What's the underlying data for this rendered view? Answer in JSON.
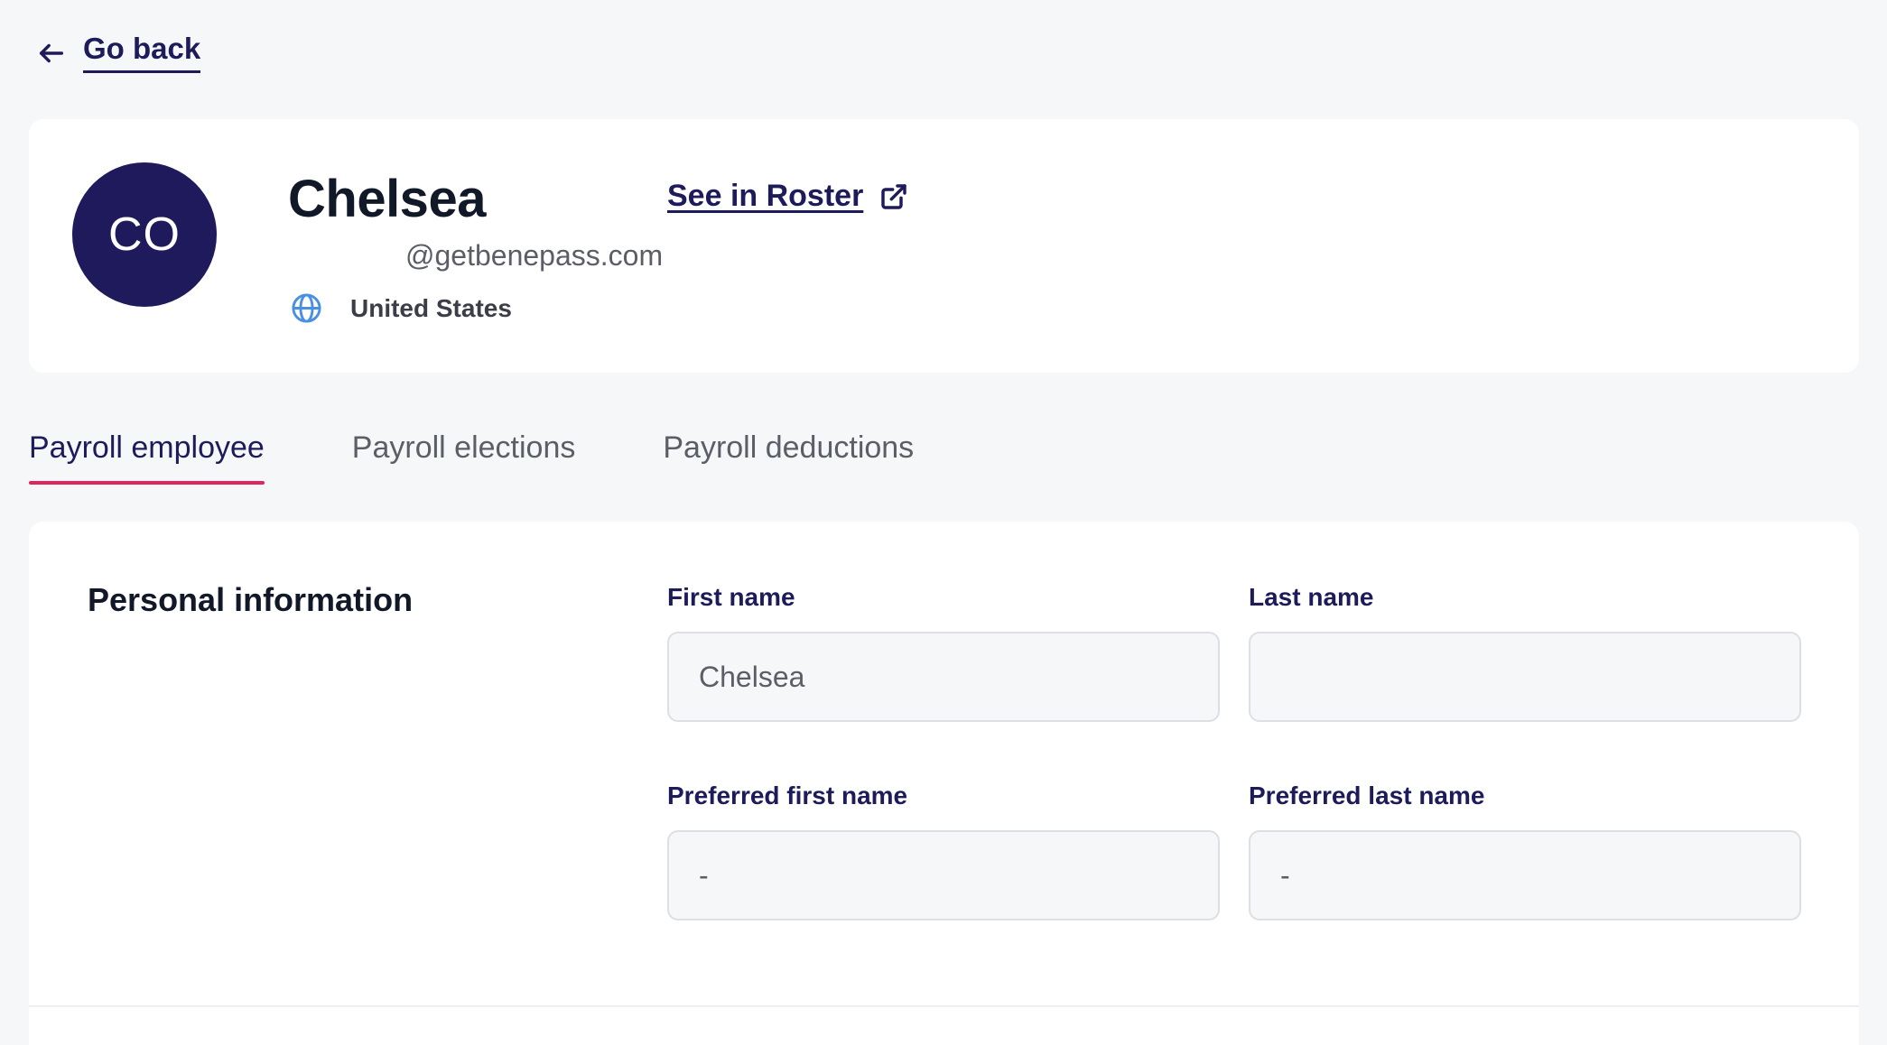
{
  "go_back": {
    "label": "Go back",
    "icon": "arrow-left-icon"
  },
  "profile": {
    "initials": "CO",
    "name": "Chelsea",
    "email": "@getbenepass.com",
    "country": "United States",
    "country_icon": "globe-icon",
    "roster_link": {
      "label": "See in Roster",
      "icon": "external-link-icon"
    }
  },
  "tabs": [
    {
      "label": "Payroll employee",
      "active": true
    },
    {
      "label": "Payroll elections",
      "active": false
    },
    {
      "label": "Payroll deductions",
      "active": false
    }
  ],
  "personal_info": {
    "title": "Personal information",
    "fields": {
      "first_name": {
        "label": "First name",
        "value": "Chelsea"
      },
      "last_name": {
        "label": "Last name",
        "value": ""
      },
      "preferred_first_name": {
        "label": "Preferred first name",
        "value": "-"
      },
      "preferred_last_name": {
        "label": "Preferred last name",
        "value": "-"
      }
    }
  },
  "colors": {
    "accent": "#1e1b5a",
    "avatar_bg": "#1f1a5c",
    "tab_indicator": "#e0245e",
    "globe": "#4a90e2",
    "background": "#f6f7f9"
  }
}
